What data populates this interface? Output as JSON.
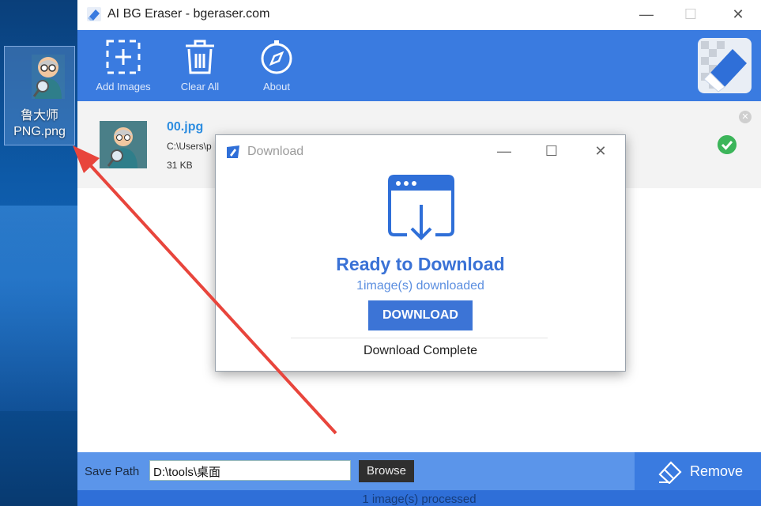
{
  "desktop": {
    "icon_label_line1": "鲁大师",
    "icon_label_line2": "PNG.png"
  },
  "window": {
    "title": "AI BG Eraser - bgeraser.com",
    "minimize": "—",
    "maximize": "☐",
    "close": "✕"
  },
  "toolbar": {
    "add_images": "Add Images",
    "clear_all": "Clear All",
    "about": "About"
  },
  "file": {
    "name": "00.jpg",
    "path": "C:\\Users\\p",
    "size": "31 KB",
    "remove": "✕"
  },
  "dialog": {
    "title": "Download",
    "minimize": "—",
    "maximize": "☐",
    "close": "✕",
    "heading": "Ready to Download",
    "subtext": "1image(s) downloaded",
    "download_button": "DOWNLOAD",
    "complete_text": "Download Complete"
  },
  "bottom": {
    "save_path_label": "Save Path",
    "save_path_value": "D:\\tools\\桌面",
    "browse_button": "Browse",
    "remove_button": "Remove"
  },
  "status": {
    "text": "1 image(s) processed"
  },
  "colors": {
    "accent": "#3a7be0",
    "success": "#3cb55a",
    "annotation_arrow": "#e8453c"
  }
}
